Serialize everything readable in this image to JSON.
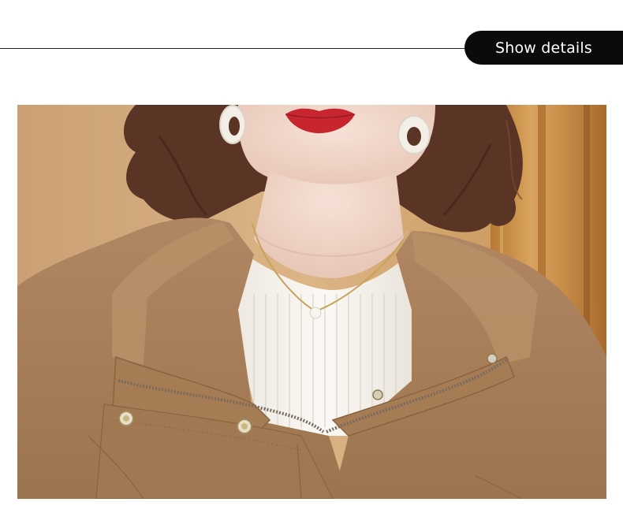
{
  "header": {
    "details_button_label": "Show details"
  },
  "photo": {
    "subject": "product-photo",
    "colors": {
      "background": "#d4a978",
      "wood_panel": "#c98f4a",
      "coat": "#a67c55",
      "sweater": "#f4f1ec",
      "hair": "#5a3424",
      "lips": "#c8262f"
    }
  }
}
